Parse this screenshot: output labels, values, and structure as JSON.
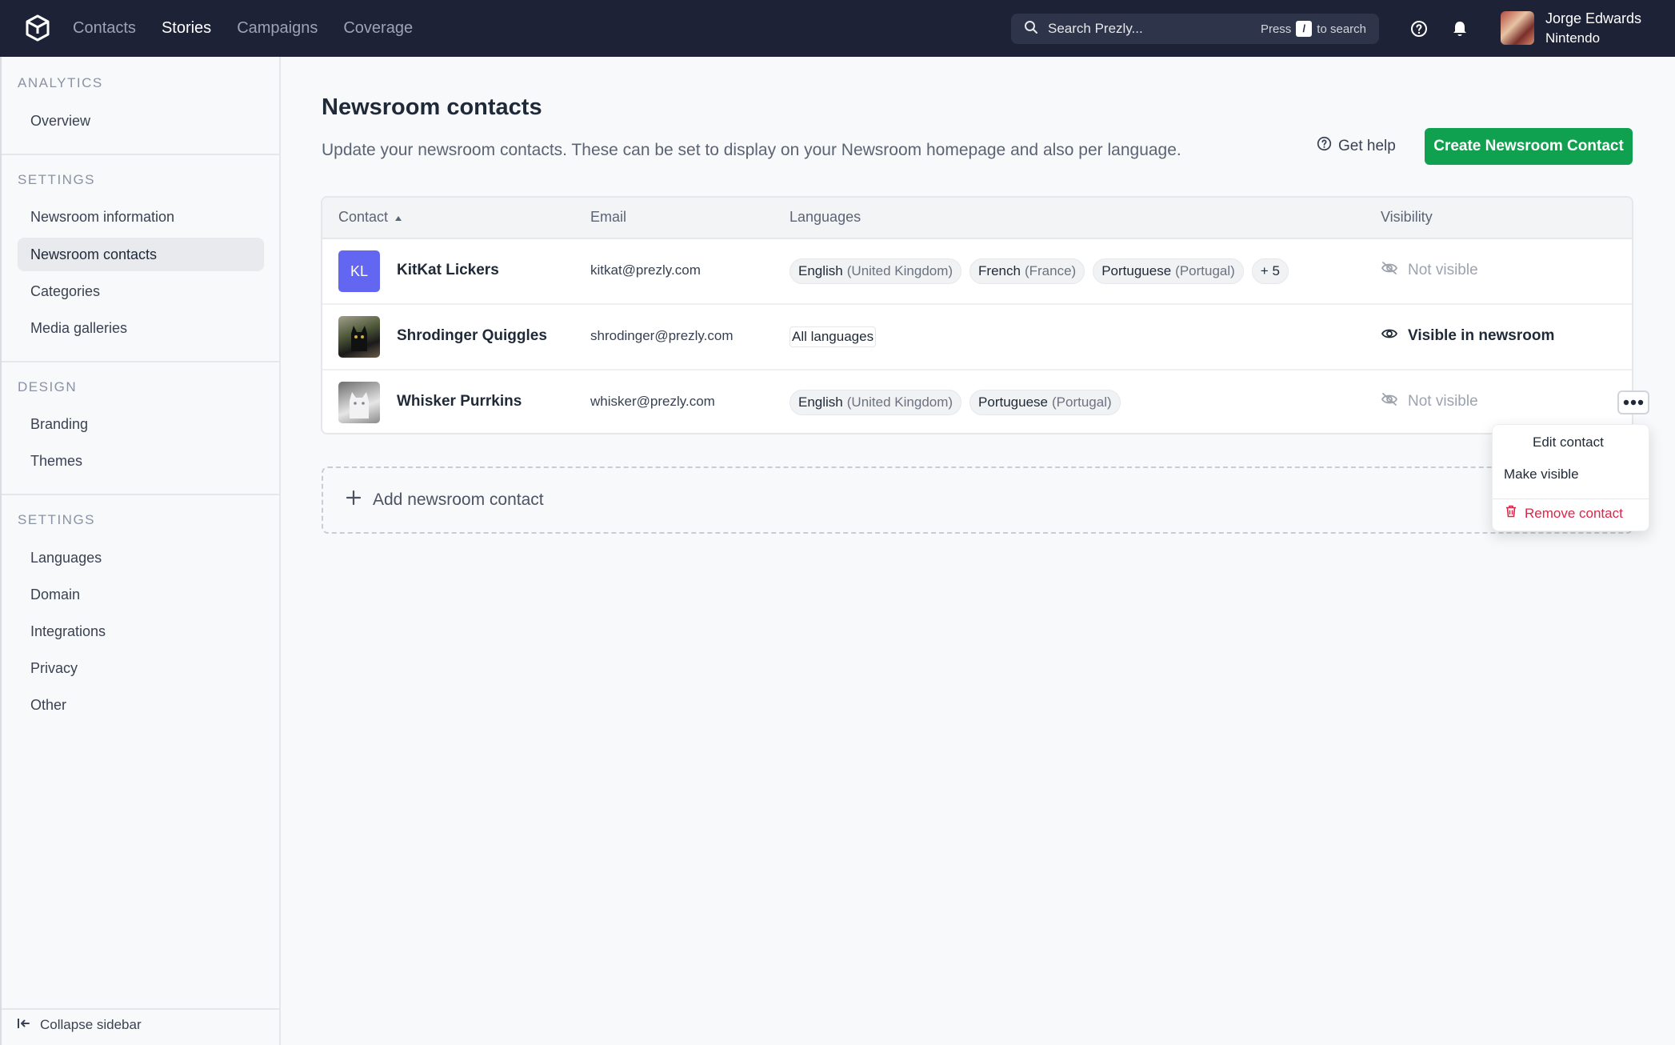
{
  "nav": {
    "items": [
      {
        "label": "Contacts"
      },
      {
        "label": "Stories"
      },
      {
        "label": "Campaigns"
      },
      {
        "label": "Coverage"
      }
    ]
  },
  "search": {
    "placeholder": "Search Prezly...",
    "hint_prefix": "Press",
    "hint_key": "/",
    "hint_suffix": "to search"
  },
  "user": {
    "name": "Jorge Edwards",
    "org": "Nintendo"
  },
  "sidebar": {
    "sections": [
      {
        "heading": "ANALYTICS",
        "items": [
          "Overview"
        ]
      },
      {
        "heading": "SETTINGS",
        "items": [
          "Newsroom information",
          "Newsroom contacts",
          "Categories",
          "Media galleries"
        ]
      },
      {
        "heading": "DESIGN",
        "items": [
          "Branding",
          "Themes"
        ]
      },
      {
        "heading": "SETTINGS",
        "items": [
          "Languages",
          "Domain",
          "Integrations",
          "Privacy",
          "Other"
        ]
      }
    ],
    "collapse_label": "Collapse sidebar"
  },
  "page": {
    "title": "Newsroom contacts",
    "subtitle": "Update your newsroom contacts. These can be set to display on your Newsroom homepage and also per language.",
    "help_label": "Get help",
    "create_label": "Create Newsroom Contact"
  },
  "table": {
    "headers": {
      "contact": "Contact",
      "email": "Email",
      "languages": "Languages",
      "visibility": "Visibility"
    },
    "rows": [
      {
        "initials": "KL",
        "name": "KitKat Lickers",
        "email": "kitkat@prezly.com",
        "languages": [
          {
            "lang": "English",
            "region": "(United Kingdom)"
          },
          {
            "lang": "French",
            "region": "(France)"
          },
          {
            "lang": "Portuguese",
            "region": "(Portugal)"
          }
        ],
        "more_langs": "+ 5",
        "visibility": "Not visible"
      },
      {
        "name": "Shrodinger Quiggles",
        "email": "shrodinger@prezly.com",
        "languages_all": "All languages",
        "visibility": "Visible in newsroom"
      },
      {
        "name": "Whisker Purrkins",
        "email": "whisker@prezly.com",
        "languages": [
          {
            "lang": "English",
            "region": "(United Kingdom)"
          },
          {
            "lang": "Portuguese",
            "region": "(Portugal)"
          }
        ],
        "visibility": "Not visible"
      }
    ]
  },
  "menu": {
    "edit": "Edit contact",
    "make_visible": "Make visible",
    "remove": "Remove contact"
  },
  "add_contact_label": "Add newsroom contact",
  "colors": {
    "accent_green": "#0fa14f",
    "danger": "#dc2647",
    "topbar": "#1d2237",
    "initials_bg": "#6366f1"
  }
}
